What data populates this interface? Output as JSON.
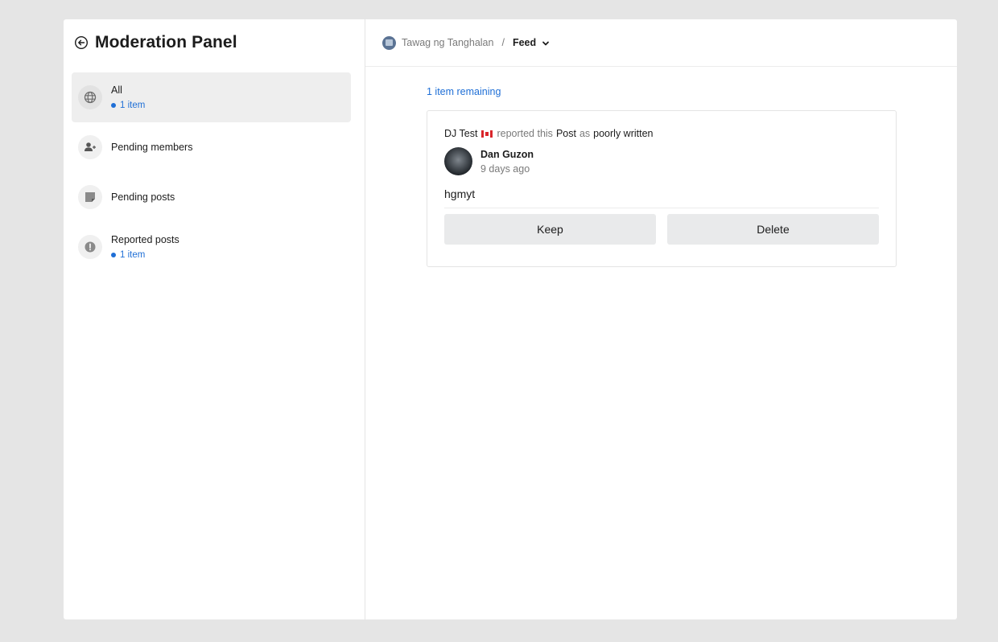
{
  "sidebar": {
    "title": "Moderation Panel",
    "items": [
      {
        "label": "All",
        "count": "1 item",
        "icon": "globe-icon"
      },
      {
        "label": "Pending members",
        "icon": "add-user-icon"
      },
      {
        "label": "Pending posts",
        "icon": "note-icon"
      },
      {
        "label": "Reported posts",
        "count": "1 item",
        "icon": "alert-icon"
      }
    ]
  },
  "breadcrumb": {
    "community": "Tawag ng Tanghalan",
    "separator": "/",
    "feed": "Feed"
  },
  "main": {
    "remaining": "1 item remaining"
  },
  "report": {
    "reporter": "DJ Test",
    "reported_this": "reported this",
    "object": "Post",
    "as": "as",
    "reason": "poorly written",
    "author_name": "Dan Guzon",
    "time": "9 days ago",
    "body": "hgmyt",
    "keep_label": "Keep",
    "delete_label": "Delete"
  },
  "colors": {
    "accent": "#1f6fd6",
    "background": "#e5e5e5",
    "button": "#e9eaeb"
  }
}
